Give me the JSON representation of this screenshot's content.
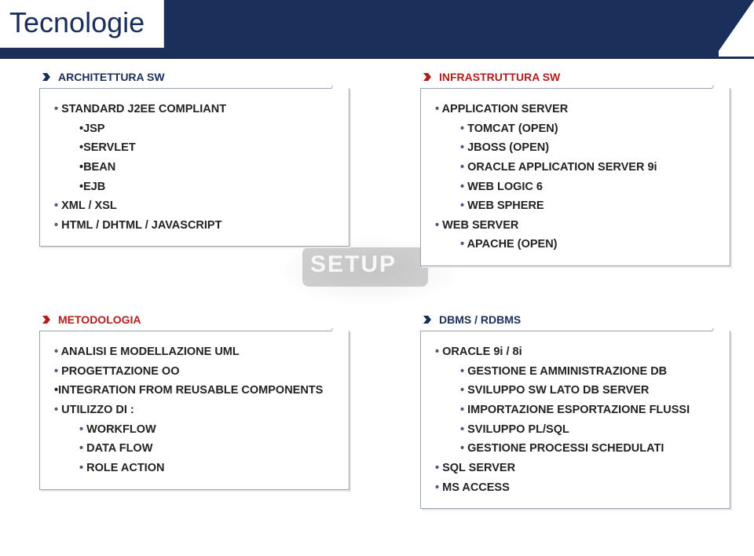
{
  "title": "Tecnologie",
  "watermark": "SETUP",
  "sections": {
    "arch": {
      "label": "ARCHITETTURA SW",
      "items": [
        {
          "level": 0,
          "bullet": true,
          "text": "STANDARD J2EE COMPLIANT"
        },
        {
          "level": 1,
          "bullet": false,
          "text": "•JSP"
        },
        {
          "level": 1,
          "bullet": false,
          "text": "•SERVLET"
        },
        {
          "level": 1,
          "bullet": false,
          "text": "•BEAN"
        },
        {
          "level": 1,
          "bullet": false,
          "text": "•EJB"
        },
        {
          "level": 0,
          "bullet": true,
          "text": "XML / XSL"
        },
        {
          "level": 0,
          "bullet": true,
          "text": "HTML / DHTML / JAVASCRIPT"
        }
      ]
    },
    "infra": {
      "label": "INFRASTRUTTURA SW",
      "items": [
        {
          "level": 0,
          "bullet": true,
          "text": "APPLICATION SERVER"
        },
        {
          "level": 1,
          "bullet": true,
          "text": "TOMCAT (OPEN)"
        },
        {
          "level": 1,
          "bullet": true,
          "text": "JBOSS (OPEN)"
        },
        {
          "level": 1,
          "bullet": true,
          "text": "ORACLE APPLICATION SERVER 9i"
        },
        {
          "level": 1,
          "bullet": true,
          "text": "WEB LOGIC 6"
        },
        {
          "level": 1,
          "bullet": true,
          "text": "WEB SPHERE"
        },
        {
          "level": 0,
          "bullet": true,
          "text": "WEB SERVER"
        },
        {
          "level": 1,
          "bullet": true,
          "text": "APACHE (OPEN)"
        }
      ]
    },
    "method": {
      "label": "METODOLOGIA",
      "items": [
        {
          "level": 0,
          "bullet": true,
          "text": "ANALISI E MODELLAZIONE UML"
        },
        {
          "level": 0,
          "bullet": true,
          "text": "PROGETTAZIONE OO"
        },
        {
          "level": 0,
          "bullet": false,
          "text": "•INTEGRATION FROM REUSABLE COMPONENTS"
        },
        {
          "level": 0,
          "bullet": true,
          "text": "UTILIZZO DI :"
        },
        {
          "level": 1,
          "bullet": true,
          "text": "WORKFLOW"
        },
        {
          "level": 1,
          "bullet": true,
          "text": "DATA FLOW"
        },
        {
          "level": 1,
          "bullet": true,
          "text": "ROLE ACTION"
        }
      ]
    },
    "dbms": {
      "label": "DBMS / RDBMS",
      "items": [
        {
          "level": 0,
          "bullet": true,
          "text": "ORACLE 9i / 8i"
        },
        {
          "level": 1,
          "bullet": true,
          "text": "GESTIONE E AMMINISTRAZIONE DB"
        },
        {
          "level": 1,
          "bullet": true,
          "text": "SVILUPPO SW LATO DB SERVER"
        },
        {
          "level": 1,
          "bullet": true,
          "text": "IMPORTAZIONE ESPORTAZIONE FLUSSI"
        },
        {
          "level": 1,
          "bullet": true,
          "text": "SVILUPPO PL/SQL"
        },
        {
          "level": 1,
          "bullet": true,
          "text": "GESTIONE PROCESSI SCHEDULATI"
        },
        {
          "level": 0,
          "bullet": true,
          "text": "SQL SERVER"
        },
        {
          "level": 0,
          "bullet": true,
          "text": "MS ACCESS"
        }
      ]
    }
  },
  "colors": {
    "blue": "#1a2f5a",
    "red": "#b11d1d"
  }
}
